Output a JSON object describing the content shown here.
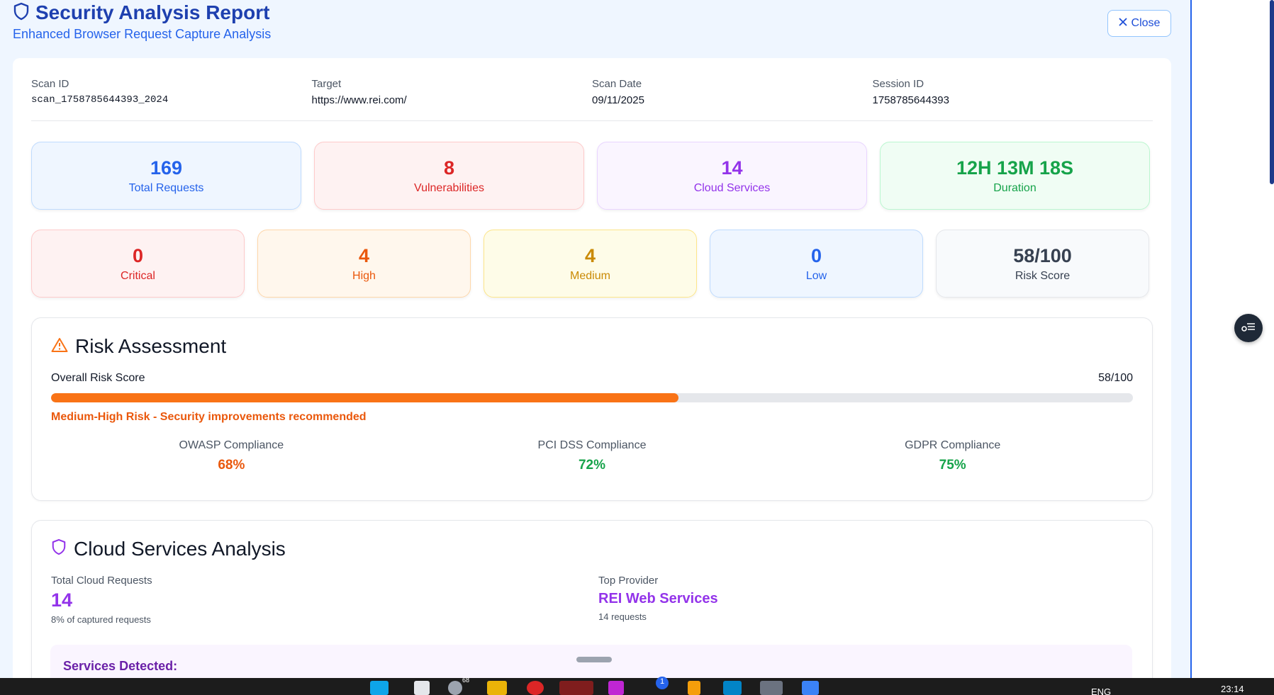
{
  "header": {
    "title": "Security Analysis Report",
    "subtitle": "Enhanced Browser Request Capture Analysis",
    "close_label": "Close"
  },
  "meta": [
    {
      "label": "Scan ID",
      "value": "scan_1758785644393_2024"
    },
    {
      "label": "Target",
      "value": "https://www.rei.com/"
    },
    {
      "label": "Scan Date",
      "value": "09/11/2025"
    },
    {
      "label": "Session ID",
      "value": "1758785644393"
    }
  ],
  "summary": [
    {
      "value": "169",
      "label": "Total Requests"
    },
    {
      "value": "8",
      "label": "Vulnerabilities"
    },
    {
      "value": "14",
      "label": "Cloud Services"
    },
    {
      "value": "12H 13M 18S",
      "label": "Duration"
    }
  ],
  "severity": [
    {
      "value": "0",
      "label": "Critical"
    },
    {
      "value": "4",
      "label": "High"
    },
    {
      "value": "4",
      "label": "Medium"
    },
    {
      "value": "0",
      "label": "Low"
    },
    {
      "value": "58/100",
      "label": "Risk Score"
    }
  ],
  "risk": {
    "title": "Risk Assessment",
    "overall_label": "Overall Risk Score",
    "score_text": "58/100",
    "score_fraction": 0.58,
    "message": "Medium-High Risk - Security improvements recommended",
    "compliance": [
      {
        "label": "OWASP Compliance",
        "value": "68%"
      },
      {
        "label": "PCI DSS Compliance",
        "value": "72%"
      },
      {
        "label": "GDPR Compliance",
        "value": "75%"
      }
    ]
  },
  "cloud": {
    "title": "Cloud Services Analysis",
    "total_label": "Total Cloud Requests",
    "total_value": "14",
    "total_note": "8% of captured requests",
    "provider_label": "Top Provider",
    "provider_value": "REI Web Services",
    "provider_note": "14 requests",
    "services_label": "Services Detected:"
  },
  "taskbar": {
    "badge_count": "68",
    "notif_count": "1",
    "language": "ENG",
    "time": "23:14"
  },
  "colors": {
    "accent": "#1e40af",
    "progress": "#f97316",
    "blue": "#2563eb",
    "red": "#dc2626",
    "purple": "#9333ea",
    "green": "#16a34a",
    "orange": "#ea580c",
    "amber": "#ca8a04"
  }
}
